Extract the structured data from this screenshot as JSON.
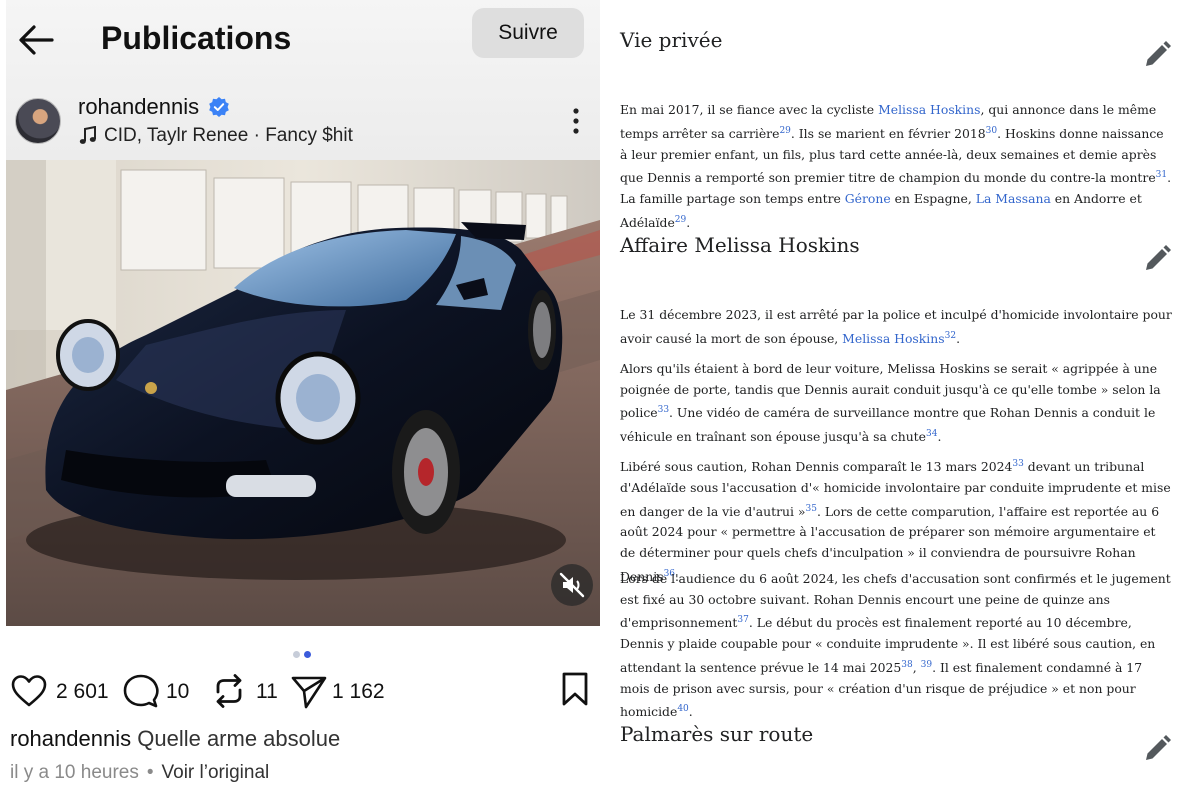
{
  "post_view": {
    "header": {
      "title": "Publications",
      "follow_label": "Suivre"
    },
    "author": {
      "username": "rohandennis",
      "verified": true,
      "music": "CID, Taylr Renee · Fancy $hit"
    },
    "icons": {
      "back": "arrow-left-icon",
      "verified": "verified-badge-icon",
      "music": "music-note-icon",
      "more": "more-vertical-icon",
      "mute": "speaker-muted-icon",
      "like": "heart-icon",
      "comment": "comment-bubble-icon",
      "repost": "repost-icon",
      "share": "send-icon",
      "bookmark": "bookmark-icon"
    },
    "media": {
      "description_alt": "Black Porsche 911 GT3",
      "carousel_count": 2,
      "carousel_active": 2
    },
    "actions": {
      "likes": "2 601",
      "comments": "10",
      "reposts": "11",
      "shares": "1 162"
    },
    "caption": {
      "username": "rohandennis",
      "text": "Quelle arme absolue"
    },
    "meta": {
      "time": "il y a 10 heures",
      "separator": "•",
      "see_original": "Voir l’original"
    },
    "colors": {
      "verified_blue": "#3b82f6",
      "dot_active": "#3b5bdb",
      "dot_inactive": "#c7cdd9"
    }
  },
  "article": {
    "colors": {
      "link": "#3366cc",
      "text": "#202122"
    },
    "sections": [
      {
        "heading": "Vie privée",
        "paragraphs": [
          [
            {
              "t": "En mai 2017, il se fiance avec la cycliste "
            },
            {
              "t": "Melissa Hoskins",
              "link": true
            },
            {
              "t": ", qui annonce dans le même temps arrêter sa carrière"
            },
            {
              "t": "29",
              "ref": true
            },
            {
              "t": ". Ils se marient en février 2018"
            },
            {
              "t": "30",
              "ref": true
            },
            {
              "t": ". Hoskins donne naissance à leur premier enfant, un fils, plus tard cette année-là, deux semaines et demie après que Dennis a remporté son premier titre de champion du monde du contre-la montre"
            },
            {
              "t": "31",
              "ref": true
            },
            {
              "t": ". La famille partage son temps entre "
            },
            {
              "t": "Gérone",
              "link": true
            },
            {
              "t": " en Espagne, "
            },
            {
              "t": "La Massana",
              "link": true
            },
            {
              "t": " en Andorre et Adélaïde"
            },
            {
              "t": "29",
              "ref": true
            },
            {
              "t": "."
            }
          ]
        ]
      },
      {
        "heading": "Affaire Melissa Hoskins",
        "paragraphs": [
          [
            {
              "t": "Le 31 décembre 2023, il est arrêté par la police et inculpé d'homicide involontaire pour avoir causé la mort de son épouse, "
            },
            {
              "t": "Melissa Hoskins",
              "link": true
            },
            {
              "t": "32",
              "ref": true
            },
            {
              "t": "."
            }
          ],
          [
            {
              "t": "Alors qu'ils étaient à bord de leur voiture, Melissa Hoskins se serait « agrippée à une poignée de porte, tandis que Dennis aurait conduit jusqu'à ce qu'elle tombe » selon la police"
            },
            {
              "t": "33",
              "ref": true
            },
            {
              "t": ". Une vidéo de caméra de surveillance montre que Rohan Dennis a conduit le véhicule en traînant son épouse jusqu'à sa chute"
            },
            {
              "t": "34",
              "ref": true
            },
            {
              "t": "."
            }
          ],
          [
            {
              "t": "Libéré sous caution, Rohan Dennis comparaît le 13 mars 2024"
            },
            {
              "t": "33",
              "ref": true
            },
            {
              "t": " devant un tribunal d'Adélaïde sous l'accusation d'« homicide involontaire par conduite imprudente et mise en danger de la vie d'autrui »"
            },
            {
              "t": "35",
              "ref": true
            },
            {
              "t": ". Lors de cette comparution, l'affaire est reportée au 6 août 2024 pour « permettre à l'accusation de préparer son mémoire argumentaire et de déterminer pour quels chefs d'inculpation » il conviendra de poursuivre Rohan Dennis"
            },
            {
              "t": "36",
              "ref": true
            },
            {
              "t": "."
            }
          ],
          [
            {
              "t": "Lors de l'audience du 6 août 2024, les chefs d'accusation sont confirmés et le jugement est fixé au 30 octobre suivant. Rohan Dennis encourt une peine de quinze ans d'emprisonnement"
            },
            {
              "t": "37",
              "ref": true
            },
            {
              "t": ". Le début du procès est finalement reporté au 10 décembre, Dennis y plaide coupable pour « conduite imprudente ». Il est libéré sous caution, en attendant la sentence prévue le 14 mai 2025"
            },
            {
              "t": "38",
              "ref": true
            },
            {
              "t": ", "
            },
            {
              "t": "39",
              "ref": true
            },
            {
              "t": ". Il est finalement condamné à 17 mois de prison avec sursis, pour « création d'un risque de préjudice » et non pour homicide"
            },
            {
              "t": "40",
              "ref": true
            },
            {
              "t": "."
            }
          ]
        ]
      },
      {
        "heading": "Palmarès sur route",
        "paragraphs": []
      }
    ]
  }
}
